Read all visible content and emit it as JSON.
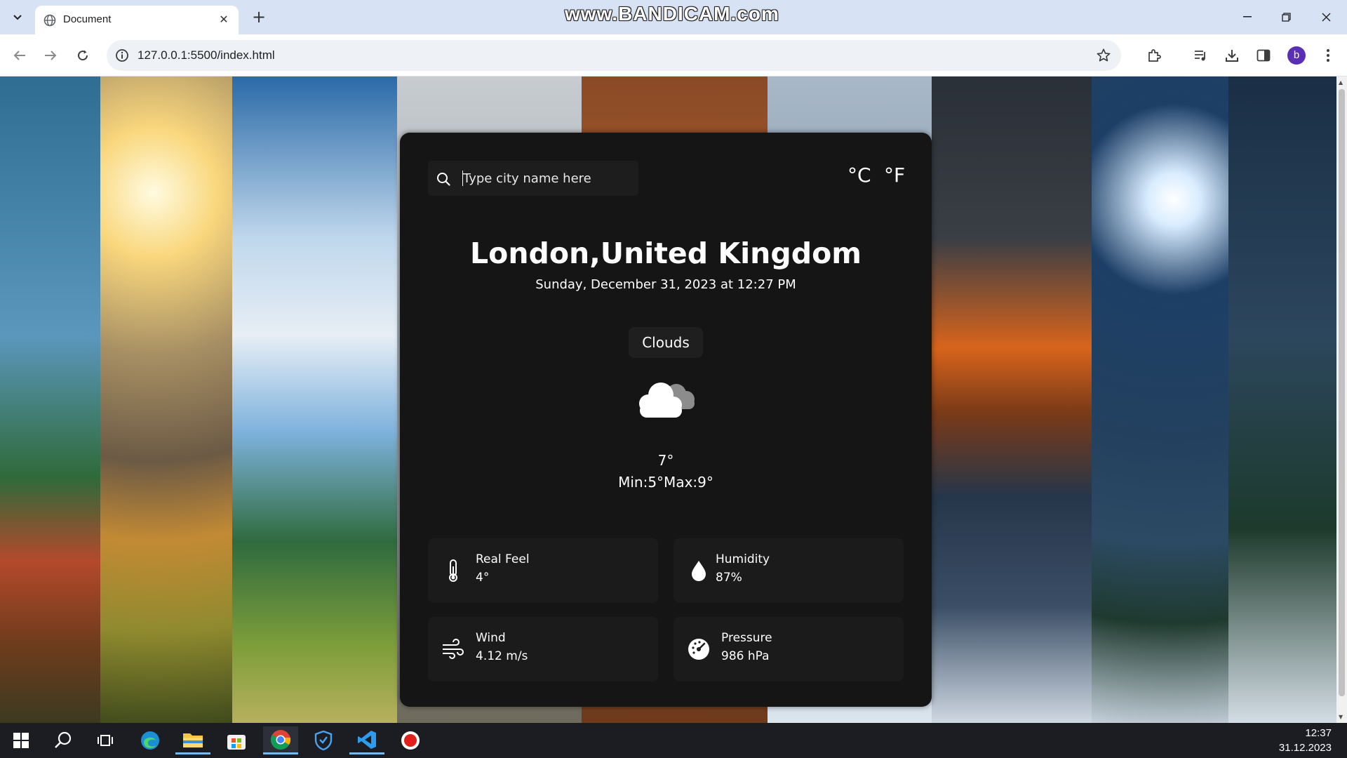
{
  "browser": {
    "tab_title": "Document",
    "url": "127.0.0.1:5500/index.html",
    "profile_initial": "b"
  },
  "watermark": "www.BANDICAM.com",
  "weather": {
    "search_placeholder": "Type city name here",
    "unit_celsius": "°C",
    "unit_fahrenheit": "°F",
    "city": "London,United Kingdom",
    "datetime": "Sunday, December 31, 2023 at 12:27 PM",
    "condition": "Clouds",
    "condition_icon": "cloud-icon",
    "temperature": "7°",
    "min_max": "Min:5°Max:9°",
    "stats": {
      "real_feel": {
        "label": "Real Feel",
        "value": "4°",
        "icon": "thermometer-icon"
      },
      "humidity": {
        "label": "Humidity",
        "value": "87%",
        "icon": "droplet-icon"
      },
      "wind": {
        "label": "Wind",
        "value": "4.12 m/s",
        "icon": "wind-icon"
      },
      "pressure": {
        "label": "Pressure",
        "value": "986 hPa",
        "icon": "gauge-icon"
      }
    }
  },
  "taskbar": {
    "time": "12:37",
    "date": "31.12.2023"
  }
}
